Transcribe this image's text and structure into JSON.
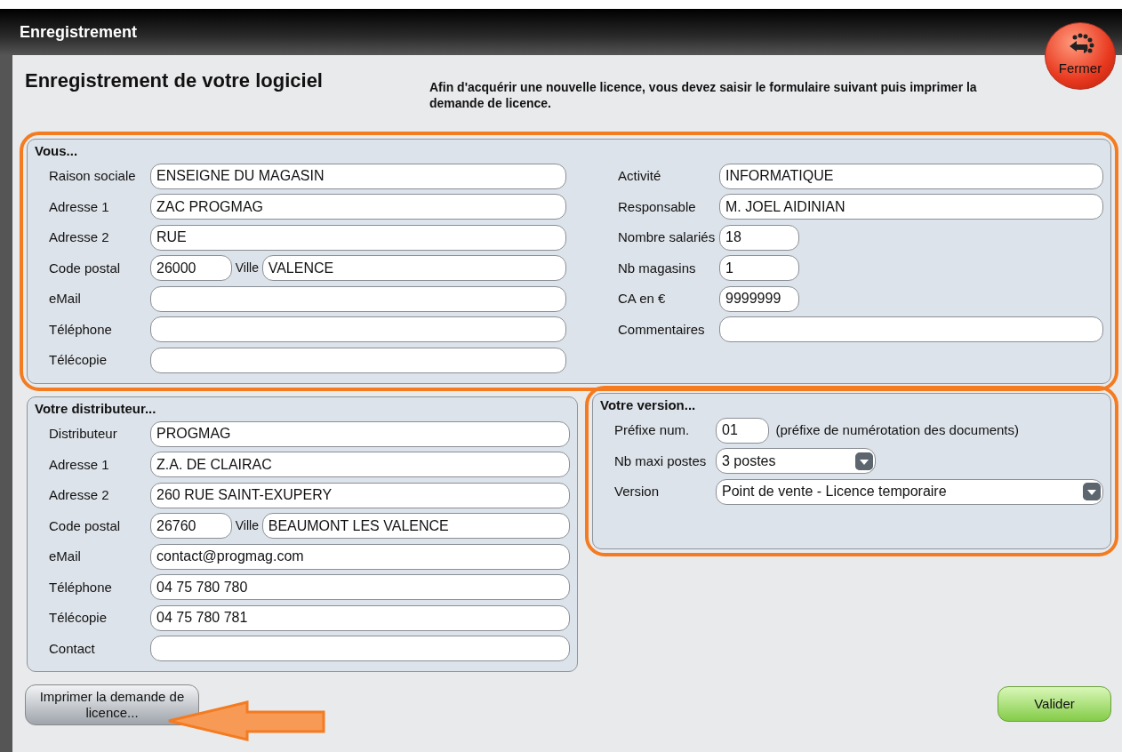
{
  "window": {
    "title": "Enregistrement"
  },
  "close_button": {
    "label": "Fermer"
  },
  "heading": "Enregistrement de votre logiciel",
  "intro": "Afin d'acquérir une nouvelle licence, vous devez saisir le formulaire suivant puis imprimer la demande de licence.",
  "vous": {
    "title": "Vous...",
    "highlighted": true,
    "left": [
      {
        "kind": "text",
        "label": "Raison sociale",
        "value": "ENSEIGNE DU MAGASIN"
      },
      {
        "kind": "text",
        "label": "Adresse 1",
        "value": "ZAC PROGMAG"
      },
      {
        "kind": "text",
        "label": "Adresse 2",
        "value": "RUE"
      },
      {
        "kind": "postal",
        "label": "Code postal",
        "value": "26000",
        "city_label": "Ville",
        "city_value": "VALENCE"
      },
      {
        "kind": "text",
        "label": "eMail"
      },
      {
        "kind": "text",
        "label": "Téléphone"
      },
      {
        "kind": "text",
        "label": "Télécopie"
      }
    ],
    "right": [
      {
        "kind": "text",
        "label": "Activité",
        "value": "INFORMATIQUE"
      },
      {
        "kind": "text",
        "label": "Responsable",
        "value": "M. JOEL AIDINIAN"
      },
      {
        "kind": "short",
        "label": "Nombre salariés",
        "value": "18"
      },
      {
        "kind": "short",
        "label": "Nb magasins",
        "value": "1"
      },
      {
        "kind": "short",
        "label": "CA en €",
        "value": "9999999"
      },
      {
        "kind": "text",
        "label": "Commentaires"
      }
    ]
  },
  "distributeur": {
    "title": "Votre distributeur...",
    "highlighted": false,
    "fields": [
      {
        "kind": "text",
        "label": "Distributeur",
        "value": "PROGMAG"
      },
      {
        "kind": "text",
        "label": "Adresse 1",
        "value": "Z.A. DE CLAIRAC"
      },
      {
        "kind": "text",
        "label": "Adresse 2",
        "value": "260 RUE SAINT-EXUPERY"
      },
      {
        "kind": "postal",
        "label": "Code postal",
        "value": "26760",
        "city_label": "Ville",
        "city_value": "BEAUMONT LES VALENCE"
      },
      {
        "kind": "text",
        "label": "eMail",
        "value": "contact@progmag.com"
      },
      {
        "kind": "text",
        "label": "Téléphone",
        "value": "04 75 780 780"
      },
      {
        "kind": "text",
        "label": "Télécopie",
        "value": "04 75 780 781"
      },
      {
        "kind": "text",
        "label": "Contact"
      }
    ]
  },
  "version": {
    "title": "Votre version...",
    "highlighted": true,
    "fields": [
      {
        "kind": "prefix",
        "label": "Préfixe num.",
        "value": "01",
        "note": "(préfixe de numérotation des documents)"
      },
      {
        "kind": "select_short",
        "label": "Nb maxi postes",
        "value": "3 postes"
      },
      {
        "kind": "select",
        "label": "Version",
        "value": "Point de vente - Licence temporaire"
      }
    ]
  },
  "print_button": {
    "label": "Imprimer la demande de licence...",
    "annotation_arrow": true
  },
  "validate_button": {
    "label": "Valider"
  }
}
